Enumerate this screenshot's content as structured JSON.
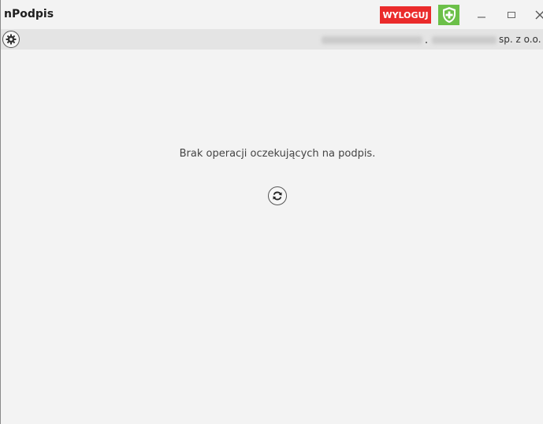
{
  "window": {
    "title": "nPodpis"
  },
  "header": {
    "logout_label": "WYLOGUJ",
    "shield_icon": "shield-plus-icon",
    "minimize_icon": "minimize-icon",
    "maximize_icon": "maximize-icon",
    "close_icon": "close-icon"
  },
  "toolbar": {
    "settings_icon": "gear-icon",
    "company_suffix": "sp. z o.o."
  },
  "main": {
    "empty_message": "Brak operacji oczekujących na podpis.",
    "refresh_icon": "refresh-icon"
  },
  "colors": {
    "logout_bg": "#ea2b2b",
    "shield_bg": "#6cc049",
    "background": "#f3f3f3",
    "toolbar_bg": "#e4e4e4"
  }
}
